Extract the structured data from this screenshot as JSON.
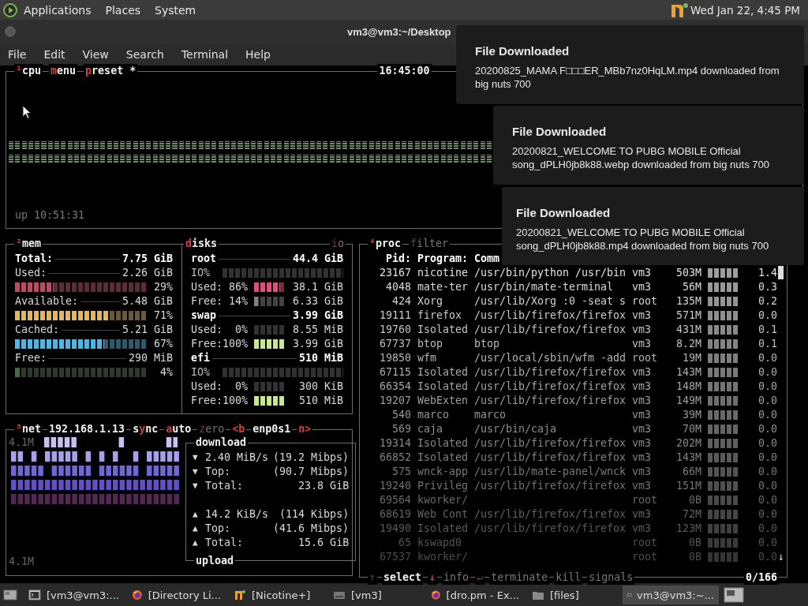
{
  "top_panel": {
    "menus": [
      "Applications",
      "Places",
      "System"
    ],
    "clock": "Wed Jan 22,  4:45 PM"
  },
  "window": {
    "title": "vm3@vm3:~/Desktop",
    "menu": [
      "File",
      "Edit",
      "View",
      "Search",
      "Terminal",
      "Help"
    ]
  },
  "cpu": {
    "titles": [
      {
        "key": "¹",
        "after": "cpu",
        "on": true
      },
      {
        "key": "m",
        "after": "enu",
        "on": true
      },
      {
        "key": "p",
        "after": "reset *",
        "on": true
      }
    ],
    "clock": "16:45:00",
    "uptime": "up 10:51:31"
  },
  "mem": {
    "titles": [
      {
        "key": "²",
        "after": "mem",
        "on": true
      }
    ],
    "rows": [
      {
        "kind": "total",
        "label": "Total:",
        "value": "7.75 GiB"
      },
      {
        "kind": "stat",
        "label": "Used:",
        "value": "2.26 GiB"
      },
      {
        "kind": "meter",
        "level": 0.29,
        "percent": "29%",
        "color": "#c04a62"
      },
      {
        "kind": "stat",
        "label": "Available:",
        "value": "5.48 GiB"
      },
      {
        "kind": "meter",
        "level": 0.71,
        "percent": "71%",
        "color": "#e0b860"
      },
      {
        "kind": "stat",
        "label": "Cached:",
        "value": "5.21 GiB"
      },
      {
        "kind": "meter",
        "level": 0.67,
        "percent": "67%",
        "color": "#48b8e8"
      },
      {
        "kind": "stat",
        "label": "Free:",
        "value": "290 MiB"
      },
      {
        "kind": "meter",
        "level": 0.04,
        "percent": "4%",
        "color": "#4a6a48"
      }
    ]
  },
  "disks": {
    "titles": [
      {
        "key": "d",
        "after": "isks",
        "on": true
      }
    ],
    "io_title": {
      "key": "i",
      "after": "o",
      "on": false
    },
    "rows": [
      {
        "kind": "header",
        "label": "root",
        "value": "44.4 GiB"
      },
      {
        "kind": "io",
        "label": "IO%",
        "level": 0
      },
      {
        "kind": "usage",
        "label": "Used:",
        "percent": "86%",
        "level": 0.86,
        "color": "#e0507a",
        "value": "38.1 GiB"
      },
      {
        "kind": "usage",
        "label": "Free:",
        "percent": "14%",
        "level": 0.14,
        "color": "#808080",
        "value": "6.33 GiB"
      },
      {
        "kind": "header",
        "label": "swap",
        "value": "3.99 GiB"
      },
      {
        "kind": "usage",
        "label": "Used:",
        "percent": "0%",
        "level": 0,
        "value": "8.55 MiB"
      },
      {
        "kind": "usage",
        "label": "Free:",
        "percent": "100%",
        "level": 1,
        "color": "#c8e890",
        "value": "3.99 GiB"
      },
      {
        "kind": "header",
        "label": "efi",
        "value": "510 MiB"
      },
      {
        "kind": "io",
        "label": "IO%",
        "level": 0
      },
      {
        "kind": "usage",
        "label": "Used:",
        "percent": "0%",
        "level": 0,
        "value": "300 KiB"
      },
      {
        "kind": "usage",
        "label": "Free:",
        "percent": "100%",
        "level": 1,
        "color": "#c8e890",
        "value": "510 MiB"
      }
    ]
  },
  "net": {
    "titles": [
      {
        "key": "³",
        "after": "net",
        "on": true
      },
      {
        "after": "192.168.1.13",
        "on": true
      },
      {
        "before": "s",
        "key": "y",
        "after": "nc",
        "on": true
      },
      {
        "key": "a",
        "after": "uto",
        "on": true
      },
      {
        "key": "z",
        "after": "ero",
        "on": false
      },
      {
        "key": "<b",
        "on": true
      },
      {
        "after": "enp0s1",
        "on": true
      },
      {
        "key": "n>",
        "on": true
      }
    ],
    "scale_top": "4.1M",
    "scale_bottom": "4.1M",
    "download": {
      "title": "download",
      "rows": [
        {
          "arrow": "▼",
          "label": "2.40 MiB/s",
          "value": "(19.2 Mibps)"
        },
        {
          "arrow": "▼",
          "label": "Top:",
          "value": "(90.7 Mibps)"
        },
        {
          "arrow": "▼",
          "label": "Total:",
          "value": "23.8 GiB"
        }
      ]
    },
    "upload": {
      "title": "upload",
      "rows": [
        {
          "arrow": "▲",
          "label": "14.2 KiB/s",
          "value": "(114 Kibps)"
        },
        {
          "arrow": "▲",
          "label": "Top:",
          "value": "(41.6 Mibps)"
        },
        {
          "arrow": "▲",
          "label": "Total:",
          "value": "15.6 GiB"
        }
      ]
    }
  },
  "proc": {
    "titles": [
      {
        "key": "⁴",
        "after": "proc",
        "on": true
      },
      {
        "key": "f",
        "after": "ilter",
        "on": false
      }
    ],
    "header": [
      "Pid:",
      "Program:",
      "Comm"
    ],
    "rows": [
      {
        "pid": "23167",
        "program": "nicotine",
        "command": "/usr/bin/python /usr/bin",
        "user": "vm3",
        "mem": "503M",
        "cpu": "1.4"
      },
      {
        "pid": "4048",
        "program": "mate-ter",
        "command": "/usr/bin/mate-terminal",
        "user": "vm3",
        "mem": "56M",
        "cpu": "0.3"
      },
      {
        "pid": "424",
        "program": "Xorg",
        "command": "/usr/lib/Xorg :0 -seat s",
        "user": "root",
        "mem": "135M",
        "cpu": "0.2"
      },
      {
        "pid": "19111",
        "program": "firefox",
        "command": "/usr/lib/firefox/firefox",
        "user": "vm3",
        "mem": "571M",
        "cpu": "0.0"
      },
      {
        "pid": "19760",
        "program": "Isolated",
        "command": "/usr/lib/firefox/firefox",
        "user": "vm3",
        "mem": "431M",
        "cpu": "0.1"
      },
      {
        "pid": "67737",
        "program": "btop",
        "command": "btop",
        "user": "vm3",
        "mem": "8.2M",
        "cpu": "0.1"
      },
      {
        "pid": "19850",
        "program": "wfm",
        "command": "/usr/local/sbin/wfm -add",
        "user": "root",
        "mem": "19M",
        "cpu": "0.0"
      },
      {
        "pid": "67115",
        "program": "Isolated",
        "command": "/usr/lib/firefox/firefox",
        "user": "vm3",
        "mem": "143M",
        "cpu": "0.0"
      },
      {
        "pid": "66354",
        "program": "Isolated",
        "command": "/usr/lib/firefox/firefox",
        "user": "vm3",
        "mem": "148M",
        "cpu": "0.0"
      },
      {
        "pid": "19207",
        "program": "WebExten",
        "command": "/usr/lib/firefox/firefox",
        "user": "vm3",
        "mem": "149M",
        "cpu": "0.0"
      },
      {
        "pid": "540",
        "program": "marco",
        "command": "marco",
        "user": "vm3",
        "mem": "39M",
        "cpu": "0.0"
      },
      {
        "pid": "569",
        "program": "caja",
        "command": "/usr/bin/caja",
        "user": "vm3",
        "mem": "70M",
        "cpu": "0.0"
      },
      {
        "pid": "19314",
        "program": "Isolated",
        "command": "/usr/lib/firefox/firefox",
        "user": "vm3",
        "mem": "202M",
        "cpu": "0.0"
      },
      {
        "pid": "66852",
        "program": "Isolated",
        "command": "/usr/lib/firefox/firefox",
        "user": "vm3",
        "mem": "143M",
        "cpu": "0.0"
      },
      {
        "pid": "575",
        "program": "wnck-app",
        "command": "/usr/lib/mate-panel/wnck",
        "user": "vm3",
        "mem": "66M",
        "cpu": "0.0"
      },
      {
        "pid": "19240",
        "program": "Privileg",
        "command": "/usr/lib/firefox/firefox",
        "user": "vm3",
        "mem": "151M",
        "cpu": "0.0"
      },
      {
        "pid": "69564",
        "program": "kworker/",
        "user": "root",
        "mem": "0B",
        "cpu": "0.0"
      },
      {
        "pid": "68619",
        "program": "Web Cont",
        "command": "/usr/lib/firefox/firefox",
        "user": "vm3",
        "mem": "72M",
        "cpu": "0.0"
      },
      {
        "pid": "19490",
        "program": "Isolated",
        "command": "/usr/lib/firefox/firefox",
        "user": "vm3",
        "mem": "123M",
        "cpu": "0.0"
      },
      {
        "pid": "65",
        "program": "kswapd0",
        "user": "root",
        "mem": "0B",
        "cpu": "0.0"
      },
      {
        "pid": "67537",
        "program": "kworker/",
        "user": "root",
        "mem": "0B",
        "cpu": "0.0"
      }
    ],
    "scroll_down": "↓",
    "footer": [
      {
        "key": "↑",
        "on": false
      },
      {
        "after": "select",
        "on": true
      },
      {
        "key": "↓",
        "on": true
      },
      {
        "after": "info",
        "on": false
      },
      {
        "key": "↵",
        "on": false
      },
      {
        "after": "terminate",
        "on": false
      },
      {
        "after": "kill",
        "on": false
      },
      {
        "after": "signals",
        "on": false
      }
    ],
    "count": "0/166"
  },
  "notifications": [
    {
      "title": "File Downloaded",
      "body": "20200825_MAMA F□□□ER_MBb7nz0HqLM.mp4 downloaded from big nuts 700"
    },
    {
      "title": "File Downloaded",
      "body": "20200821_WELCOME TO PUBG MOBILE Official song_dPLH0jb8k88.webp downloaded from big nuts 700"
    },
    {
      "title": "File Downloaded",
      "body": "20200821_WELCOME TO PUBG MOBILE Official song_dPLH0jb8k88.mp4 downloaded from big nuts 700"
    }
  ],
  "taskbar": [
    {
      "kind": "terminal",
      "label": "[vm3@vm3:...",
      "selected": false
    },
    {
      "kind": "firefox",
      "label": "[Directory Li...",
      "selected": false
    },
    {
      "kind": "nicotine",
      "label": "[Nicotine+]",
      "selected": false
    },
    {
      "kind": "drive",
      "label": "[vm3]",
      "selected": false
    },
    {
      "kind": "firefox",
      "label": "[dro.pm - Ex...",
      "selected": false
    },
    {
      "kind": "folder",
      "label": "[files]",
      "selected": false
    },
    {
      "kind": "terminal",
      "label": "vm3@vm3:~...",
      "selected": true
    }
  ]
}
